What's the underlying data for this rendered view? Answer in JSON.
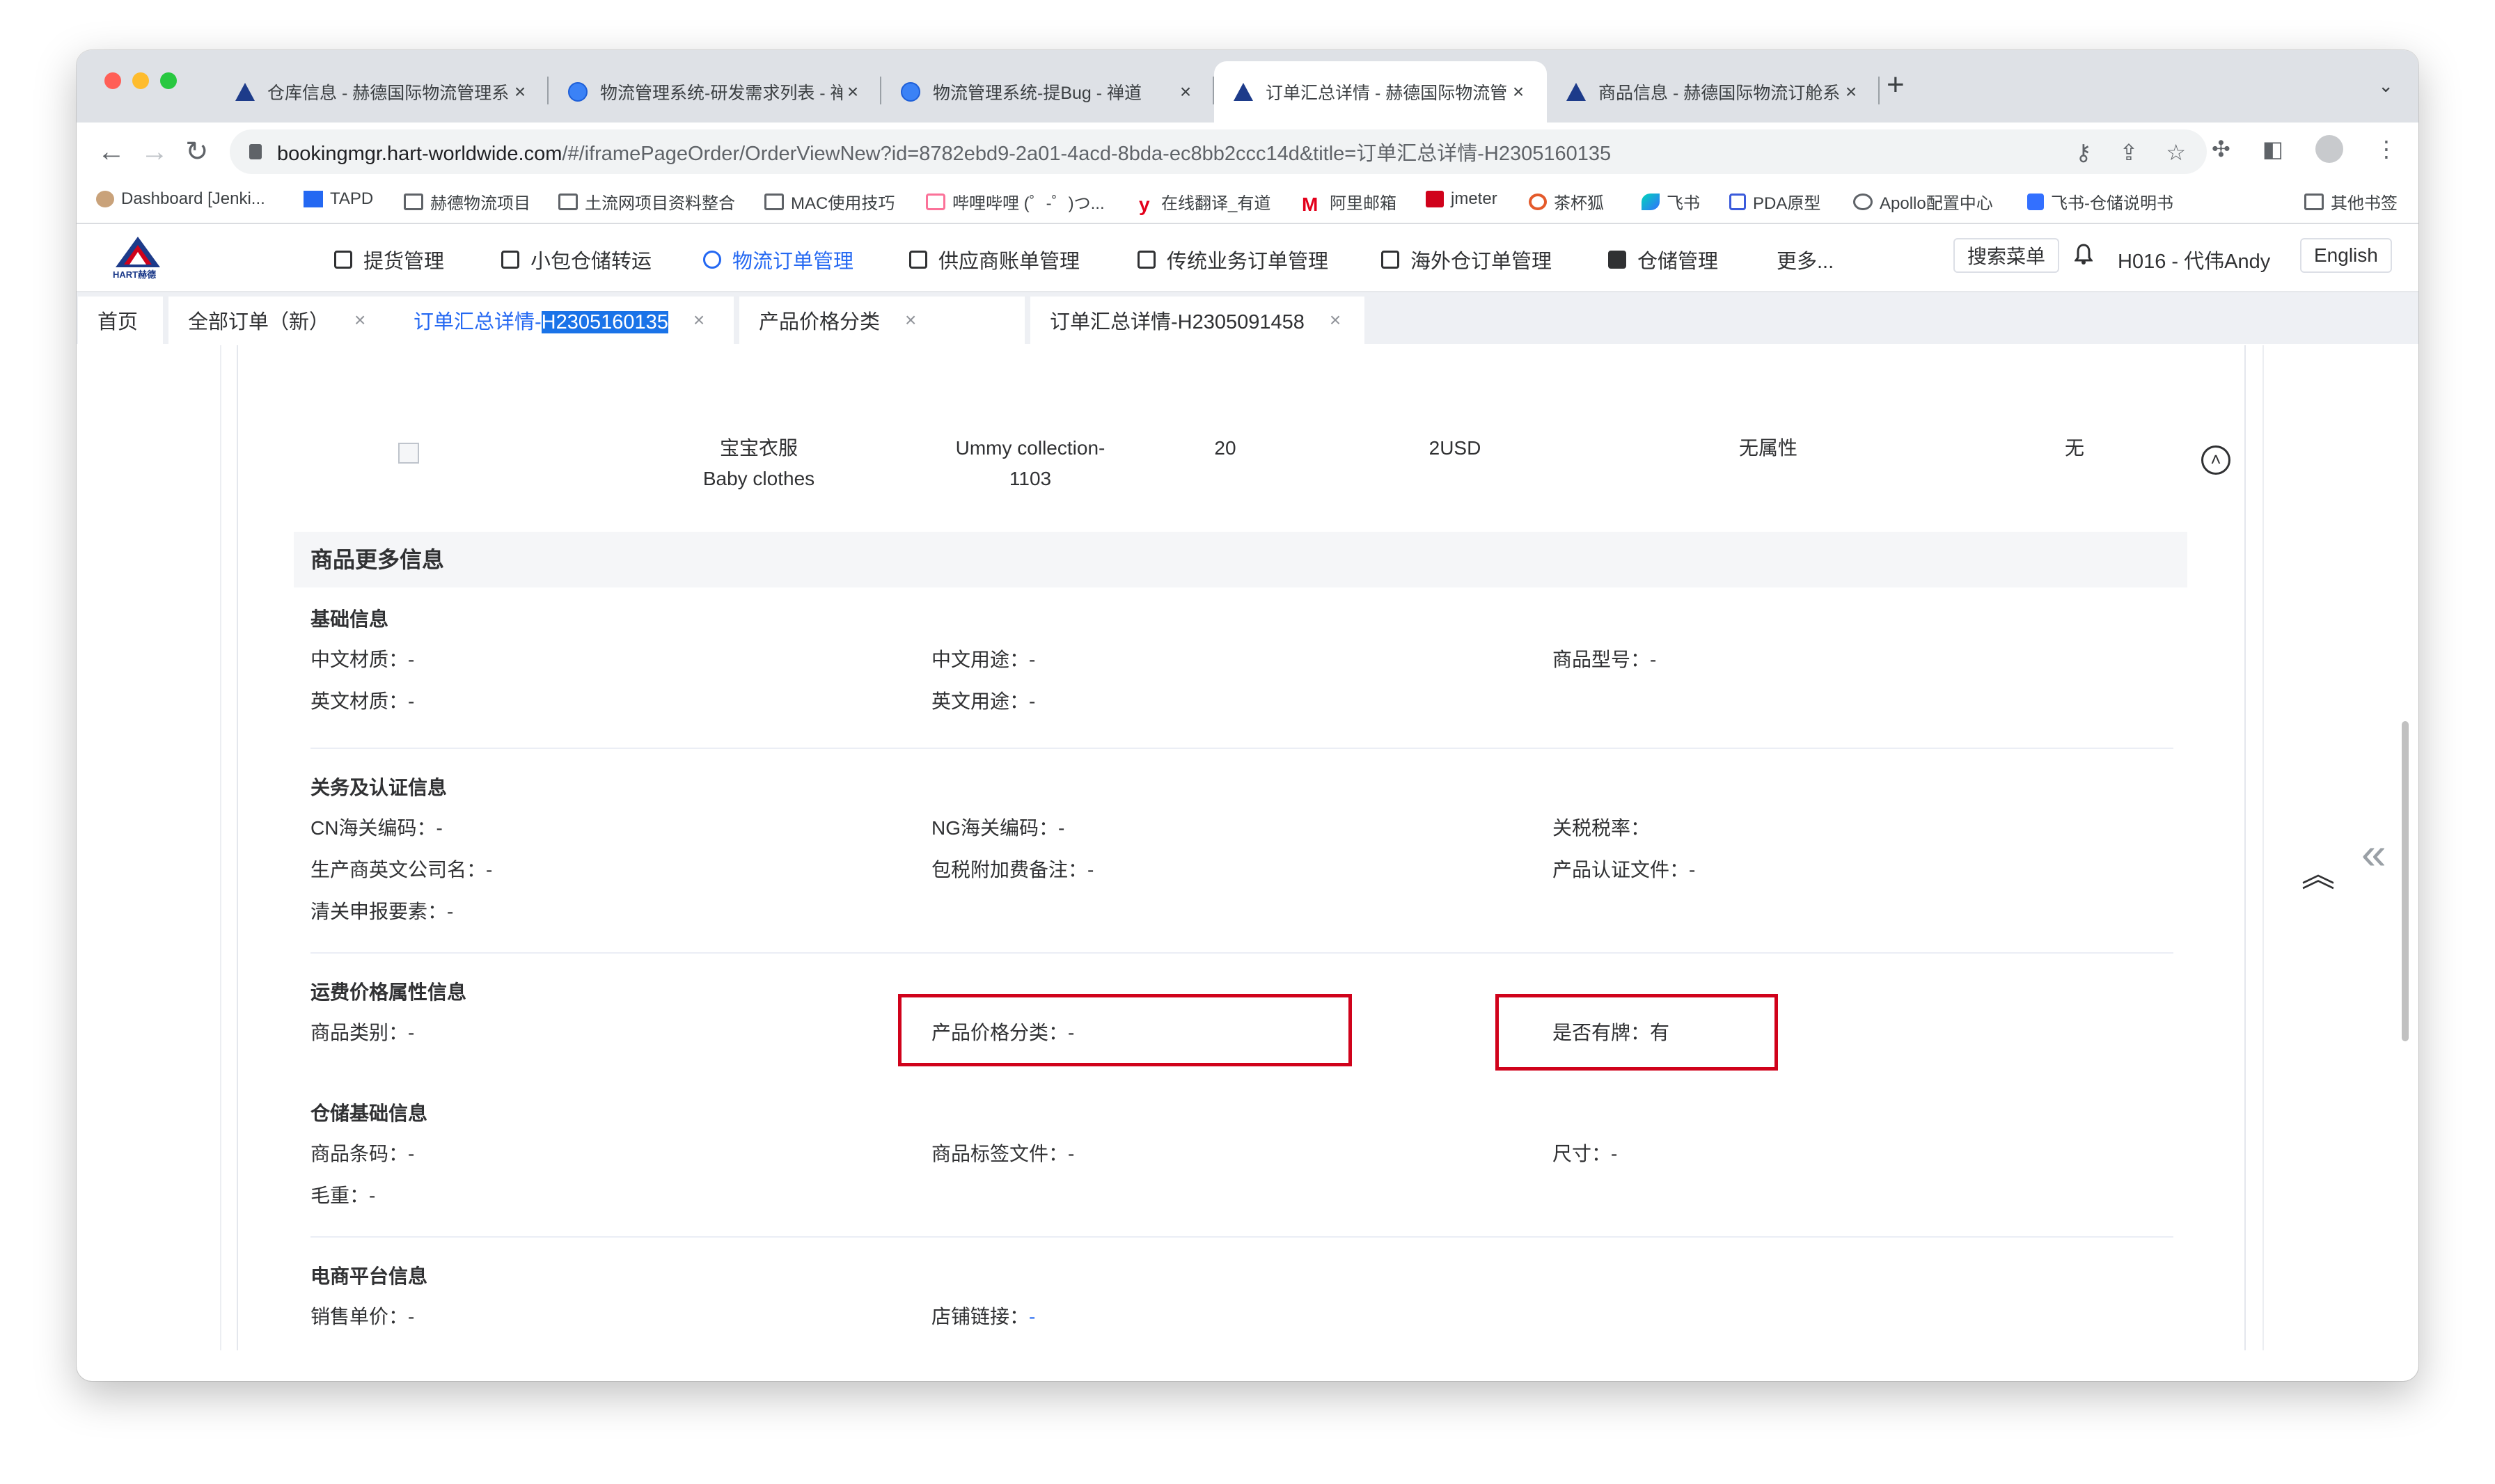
{
  "browser": {
    "tabs": [
      {
        "title": "仓库信息 - 赫德国际物流管理系统",
        "icon": "hart-logo-icon"
      },
      {
        "title": "物流管理系统-研发需求列表 - 禅道",
        "icon": "zentao-icon"
      },
      {
        "title": "物流管理系统-提Bug - 禅道",
        "icon": "zentao-icon"
      },
      {
        "title": "订单汇总详情 - 赫德国际物流管理系统",
        "icon": "hart-logo-icon",
        "active": true
      },
      {
        "title": "商品信息 - 赫德国际物流订舱系统",
        "icon": "hart-logo-icon"
      }
    ],
    "url": "bookingmgr.hart-worldwide.com",
    "url_path": "/#/iframePageOrder/OrderViewNew?id=8782ebd9-2a01-4acd-8bda-ec8bb2ccc14d&title=订单汇总详情-H2305160135",
    "bookmarks": [
      "Dashboard [Jenki...",
      "TAPD",
      "赫德物流项目",
      "土流网项目资料整合",
      "MAC使用技巧",
      "哔哩哔哩 (゜-゜)つ...",
      "在线翻译_有道",
      "阿里邮箱",
      "jmeter",
      "茶杯狐",
      "飞书",
      "PDA原型",
      "Apollo配置中心",
      "飞书-仓储说明书",
      "其他书签"
    ]
  },
  "app": {
    "logo_text": "HART赫德",
    "menu": [
      "提货管理",
      "小包仓储转运",
      "物流订单管理",
      "供应商账单管理",
      "传统业务订单管理",
      "海外仓订单管理",
      "仓储管理",
      "更多..."
    ],
    "search_menu": "搜索菜单",
    "user": "H016 - 代伟Andy",
    "language": "English"
  },
  "page_tabs": {
    "home": "首页",
    "all_orders": "全部订单（新）",
    "detail_prefix": "订单汇总详情-",
    "detail_selected": "H2305160135",
    "price_category": "产品价格分类",
    "detail2": "订单汇总详情-H2305091458",
    "close": "×"
  },
  "product_row": {
    "name_cn": "宝宝衣服",
    "name_en": "Baby clothes",
    "sku_line1": "Ummy collection-",
    "sku_line2": "1103",
    "qty": "20",
    "price": "2USD",
    "attr": "无属性",
    "other": "无"
  },
  "more_info": {
    "title": "商品更多信息",
    "basic": {
      "title": "基础信息",
      "cn_material": "中文材质：",
      "cn_use": "中文用途：",
      "model": "商品型号：",
      "en_material": "英文材质：",
      "en_use": "英文用途："
    },
    "customs": {
      "title": "关务及认证信息",
      "cn_hs": "CN海关编码：",
      "ng_hs": "NG海关编码：",
      "tax_rate": "关税税率：",
      "manufacturer": "生产商英文公司名：",
      "surcharge_note": "包税附加费备注：",
      "cert_file": "产品认证文件：",
      "declaration": "清关申报要素："
    },
    "freight": {
      "title": "运费价格属性信息",
      "category": "商品类别：",
      "price_class": "产品价格分类：",
      "branded": "是否有牌：",
      "branded_value": "有"
    },
    "warehouse": {
      "title": "仓储基础信息",
      "barcode": "商品条码：",
      "label_file": "商品标签文件：",
      "size": "尺寸：",
      "gross_weight": "毛重："
    },
    "ecommerce": {
      "title": "电商平台信息",
      "unit_price": "销售单价：",
      "shop_link": "店铺链接："
    },
    "empty": "-"
  }
}
